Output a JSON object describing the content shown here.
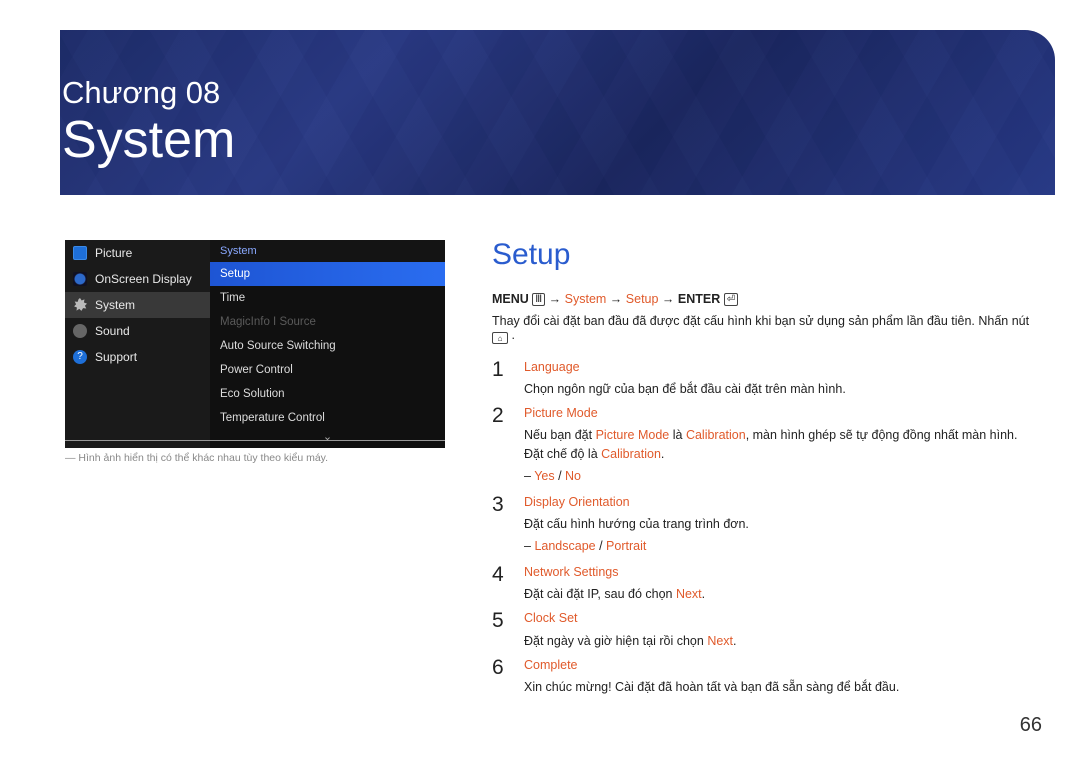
{
  "chapter_label": "Chương 08",
  "chapter_title": "System",
  "menu": {
    "left": [
      {
        "label": "Picture",
        "icon": "picture"
      },
      {
        "label": "OnScreen Display",
        "icon": "onscreen"
      },
      {
        "label": "System",
        "icon": "system",
        "active": true
      },
      {
        "label": "Sound",
        "icon": "sound"
      },
      {
        "label": "Support",
        "icon": "support",
        "glyph": "?"
      }
    ],
    "right_header": "System",
    "right_items": [
      {
        "label": "Setup",
        "selected": true
      },
      {
        "label": "Time"
      },
      {
        "label": "MagicInfo I Source",
        "dim": true
      },
      {
        "label": "Auto Source Switching"
      },
      {
        "label": "Power Control"
      },
      {
        "label": "Eco Solution"
      },
      {
        "label": "Temperature Control"
      }
    ],
    "chevron": "⌄"
  },
  "footnote": "―  Hình ảnh hiển thị có thể khác nhau tùy theo kiểu máy.",
  "section_title": "Setup",
  "path": {
    "prefix": "MENU ",
    "menu_glyph": "Ⅲ",
    "arrow": " → ",
    "system": "System",
    "setup": "Setup",
    "enter": "ENTER ",
    "enter_glyph": "⏎"
  },
  "desc": {
    "before": "Thay đổi cài đặt ban đầu đã được đặt cấu hình khi bạn sử dụng sản phẩm lần đầu tiên. Nhấn nút ",
    "home_glyph": "⌂",
    "after": " ."
  },
  "steps": [
    {
      "num": "1",
      "title_highlight": "Language",
      "line2": "Chọn ngôn ngữ của bạn để bắt đầu cài đặt trên màn hình."
    },
    {
      "num": "2",
      "title_highlight": "Picture Mode",
      "line2_parts": [
        {
          "t": "Nếu bạn đặt "
        },
        {
          "t": "Picture Mode",
          "hl": true
        },
        {
          "t": " là "
        },
        {
          "t": "Calibration",
          "hl": true
        },
        {
          "t": ", màn hình ghép sẽ tự động đồng nhất màn hình. Đặt chế độ là "
        },
        {
          "t": "Calibration",
          "hl": true
        },
        {
          "t": "."
        }
      ],
      "sub_parts": [
        {
          "t": "Yes",
          "hl": true
        },
        {
          "t": " / "
        },
        {
          "t": "No",
          "hl": true
        }
      ]
    },
    {
      "num": "3",
      "title_highlight": "Display Orientation",
      "line2": "Đặt cấu hình hướng của trang trình đơn.",
      "sub_parts": [
        {
          "t": "Landscape",
          "hl": true
        },
        {
          "t": " / "
        },
        {
          "t": "Portrait",
          "hl": true
        }
      ]
    },
    {
      "num": "4",
      "title_highlight": "Network Settings",
      "line2_parts": [
        {
          "t": "Đặt cài đặt IP, sau đó chọn "
        },
        {
          "t": "Next",
          "hl": true
        },
        {
          "t": "."
        }
      ]
    },
    {
      "num": "5",
      "title_highlight": "Clock Set",
      "line2_parts": [
        {
          "t": "Đặt ngày và giờ hiện tại rồi chọn "
        },
        {
          "t": "Next",
          "hl": true
        },
        {
          "t": "."
        }
      ]
    },
    {
      "num": "6",
      "title_highlight": "Complete",
      "line2": "Xin chúc mừng! Cài đặt đã hoàn tất và bạn đã sẵn sàng để bắt đầu."
    }
  ],
  "page_num": "66"
}
